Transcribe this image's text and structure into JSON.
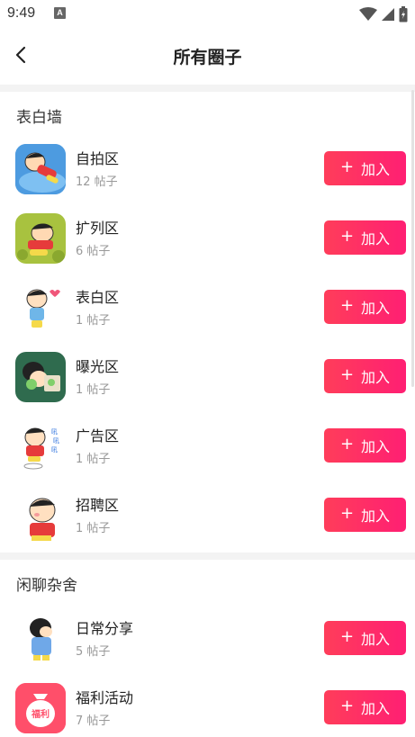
{
  "status_bar": {
    "time": "9:49",
    "notification_icon": "A"
  },
  "nav": {
    "title": "所有圈子",
    "back_icon": "chevron-left-icon"
  },
  "join_label": "加入",
  "join_plus": "+",
  "sections": [
    {
      "title": "表白墙",
      "circles": [
        {
          "name": "自拍区",
          "count": "12 帖子",
          "avatar_bg": "#5aa7e0"
        },
        {
          "name": "扩列区",
          "count": "6 帖子",
          "avatar_bg": "#9bb83a"
        },
        {
          "name": "表白区",
          "count": "1 帖子",
          "avatar_bg": "#ffffff"
        },
        {
          "name": "曝光区",
          "count": "1 帖子",
          "avatar_bg": "#2f6b4e"
        },
        {
          "name": "广告区",
          "count": "1 帖子",
          "avatar_bg": "#ffffff"
        },
        {
          "name": "招聘区",
          "count": "1 帖子",
          "avatar_bg": "#ffffff"
        }
      ]
    },
    {
      "title": "闲聊杂舍",
      "circles": [
        {
          "name": "日常分享",
          "count": "5 帖子",
          "avatar_bg": "#ffffff"
        },
        {
          "name": "福利活动",
          "count": "7 帖子",
          "avatar_bg": "#ff4f6a",
          "avatar_text": "福利"
        }
      ]
    }
  ],
  "colors": {
    "join_gradient_start": "#ff3d5a",
    "join_gradient_end": "#ff1f73",
    "divider": "#f3f3f3"
  }
}
